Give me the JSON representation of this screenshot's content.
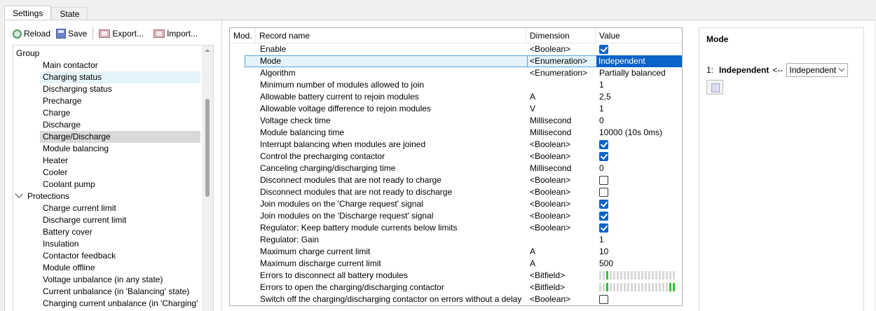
{
  "tabs": [
    {
      "label": "Settings",
      "active": true
    },
    {
      "label": "State",
      "active": false
    }
  ],
  "toolbar": {
    "reload": "Reload",
    "save": "Save",
    "export": "Export...",
    "import": "Import..."
  },
  "tree": {
    "header": "Group",
    "items": [
      {
        "label": "Main contactor",
        "level": 2,
        "state": ""
      },
      {
        "label": "Charging status",
        "level": 2,
        "state": "hover"
      },
      {
        "label": "Discharging status",
        "level": 2,
        "state": ""
      },
      {
        "label": "Precharge",
        "level": 2,
        "state": ""
      },
      {
        "label": "Charge",
        "level": 2,
        "state": ""
      },
      {
        "label": "Discharge",
        "level": 2,
        "state": ""
      },
      {
        "label": "Charge/Discharge",
        "level": 2,
        "state": "selected"
      },
      {
        "label": "Module balancing",
        "level": 2,
        "state": ""
      },
      {
        "label": "Heater",
        "level": 2,
        "state": ""
      },
      {
        "label": "Cooler",
        "level": 2,
        "state": ""
      },
      {
        "label": "Coolant pump",
        "level": 2,
        "state": ""
      },
      {
        "label": "Protections",
        "level": 1,
        "state": "expanded"
      },
      {
        "label": "Charge current limit",
        "level": 2,
        "state": ""
      },
      {
        "label": "Discharge current limit",
        "level": 2,
        "state": ""
      },
      {
        "label": "Battery cover",
        "level": 2,
        "state": ""
      },
      {
        "label": "Insulation",
        "level": 2,
        "state": ""
      },
      {
        "label": "Contactor feedback",
        "level": 2,
        "state": ""
      },
      {
        "label": "Module offline",
        "level": 2,
        "state": ""
      },
      {
        "label": "Voltage unbalance (in any state)",
        "level": 2,
        "state": ""
      },
      {
        "label": "Current unbalance (in 'Balancing' state)",
        "level": 2,
        "state": ""
      },
      {
        "label": "Charging current unbalance (in 'Charging'",
        "level": 2,
        "state": ""
      }
    ]
  },
  "grid": {
    "headers": {
      "mod": "Mod.",
      "name": "Record name",
      "dim": "Dimension",
      "val": "Value"
    },
    "rows": [
      {
        "name": "Enable",
        "dim": "<Boolean>",
        "type": "bool",
        "checked": true
      },
      {
        "name": "Mode",
        "dim": "<Enumeration>",
        "type": "text",
        "value": "Independent",
        "selected": true
      },
      {
        "name": "Algorithm",
        "dim": "<Enumeration>",
        "type": "text",
        "value": "Partially balanced"
      },
      {
        "name": "Minimum number of modules allowed to join",
        "dim": "",
        "type": "text",
        "value": "1"
      },
      {
        "name": "Allowable battery current to rejoin modules",
        "dim": "A",
        "type": "text",
        "value": "2,5"
      },
      {
        "name": "Allowable voltage difference to rejoin modules",
        "dim": "V",
        "type": "text",
        "value": "1"
      },
      {
        "name": "Voltage check time",
        "dim": "Millisecond",
        "type": "text",
        "value": "0"
      },
      {
        "name": "Module balancing time",
        "dim": "Millisecond",
        "type": "text",
        "value": "10000 (10s 0ms)"
      },
      {
        "name": "Interrupt balancing when modules are joined",
        "dim": "<Boolean>",
        "type": "bool",
        "checked": true
      },
      {
        "name": "Control the precharging contactor",
        "dim": "<Boolean>",
        "type": "bool",
        "checked": true
      },
      {
        "name": "Canceling charging/discharging time",
        "dim": "Millisecond",
        "type": "text",
        "value": "0"
      },
      {
        "name": "Disconnect modules that are not ready to charge",
        "dim": "<Boolean>",
        "type": "bool",
        "checked": false
      },
      {
        "name": "Disconnect modules that are not ready to discharge",
        "dim": "<Boolean>",
        "type": "bool",
        "checked": false
      },
      {
        "name": "Join modules on the 'Charge request' signal",
        "dim": "<Boolean>",
        "type": "bool",
        "checked": true
      },
      {
        "name": "Join modules on the 'Discharge request' signal",
        "dim": "<Boolean>",
        "type": "bool",
        "checked": true
      },
      {
        "name": "Regulator: Keep battery module currents below limits",
        "dim": "<Boolean>",
        "type": "bool",
        "checked": true
      },
      {
        "name": "Regulator: Gain",
        "dim": "",
        "type": "text",
        "value": "1"
      },
      {
        "name": "Maximum charge current limit",
        "dim": "A",
        "type": "text",
        "value": "10"
      },
      {
        "name": "Maximum discharge current limit",
        "dim": "A",
        "type": "text",
        "value": "500"
      },
      {
        "name": "Errors to disconnect all battery modules",
        "dim": "<Bitfield>",
        "type": "bits",
        "bits": [
          0,
          0,
          1,
          0,
          0,
          0,
          0,
          0,
          0,
          0,
          0,
          0,
          0,
          0,
          0,
          0,
          0,
          0,
          0,
          0,
          0,
          0
        ]
      },
      {
        "name": "Errors to open the charging/discharging contactor",
        "dim": "<Bitfield>",
        "type": "bits",
        "bits": [
          0,
          0,
          1,
          0,
          0,
          0,
          0,
          0,
          0,
          0,
          0,
          0,
          0,
          0,
          0,
          0,
          0,
          0,
          0,
          0,
          1,
          1
        ]
      },
      {
        "name": "Switch off the charging/discharging contactor on errors without a delay",
        "dim": "<Boolean>",
        "type": "bool",
        "checked": false
      }
    ]
  },
  "right_panel": {
    "title": "Mode",
    "index": "1:",
    "field": "Independent",
    "arrow": "<--",
    "select_value": "Independent"
  },
  "colors": {
    "accent": "#0a64c8",
    "bit_on": "#29c429",
    "bit_off": "#d8d8d8",
    "selected_tree": "#d9d9d9",
    "hover_tree": "#e5f3fb"
  }
}
